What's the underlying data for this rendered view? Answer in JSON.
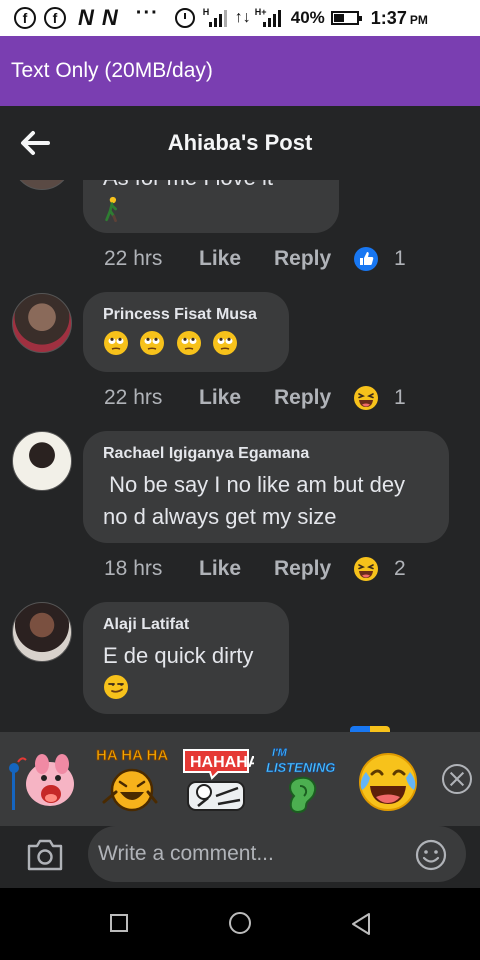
{
  "status_bar": {
    "battery": "40%",
    "time": "1:37",
    "ampm": "PM",
    "network_1": "H",
    "network_2": "H+"
  },
  "banner": {
    "text": "Text Only (20MB/day)"
  },
  "header": {
    "title": "Ahiaba's Post"
  },
  "comments": [
    {
      "partial_text": "As for me I love it",
      "time": "22 hrs",
      "like": "Like",
      "reply": "Reply",
      "reaction": "like-icon",
      "count": "1"
    },
    {
      "name": "Princess Fisat Musa",
      "emojis": [
        "eye-roll-emoji",
        "eye-roll-emoji",
        "eye-roll-emoji",
        "eye-roll-emoji"
      ],
      "time": "22 hrs",
      "like": "Like",
      "reply": "Reply",
      "reaction": "haha-icon",
      "count": "1"
    },
    {
      "name": "Rachael Igiganya Egamana",
      "text": " No be say I no like am but dey no d always get my size",
      "time": "18 hrs",
      "like": "Like",
      "reply": "Reply",
      "reaction": "haha-icon",
      "count": "2"
    },
    {
      "name": "Alaji Latifat",
      "text": "E de quick dirty",
      "emoji": "smirk-emoji"
    }
  ],
  "stickers": [
    {
      "name": "singing-pig-sticker"
    },
    {
      "name": "ha-ha-ha-sticker",
      "label": "HA HA HA"
    },
    {
      "name": "hahaha-sticker",
      "label": "HAHAHA"
    },
    {
      "name": "im-listening-sticker",
      "label": "I'M LISTENING"
    },
    {
      "name": "laughing-emoji-sticker"
    }
  ],
  "composer": {
    "placeholder": "Write a comment..."
  },
  "colors": {
    "banner": "#7a3eb1",
    "background": "#242526",
    "bubble": "#3a3b3c",
    "like_blue": "#1877f2",
    "emoji_yellow": "#f7c21b"
  }
}
